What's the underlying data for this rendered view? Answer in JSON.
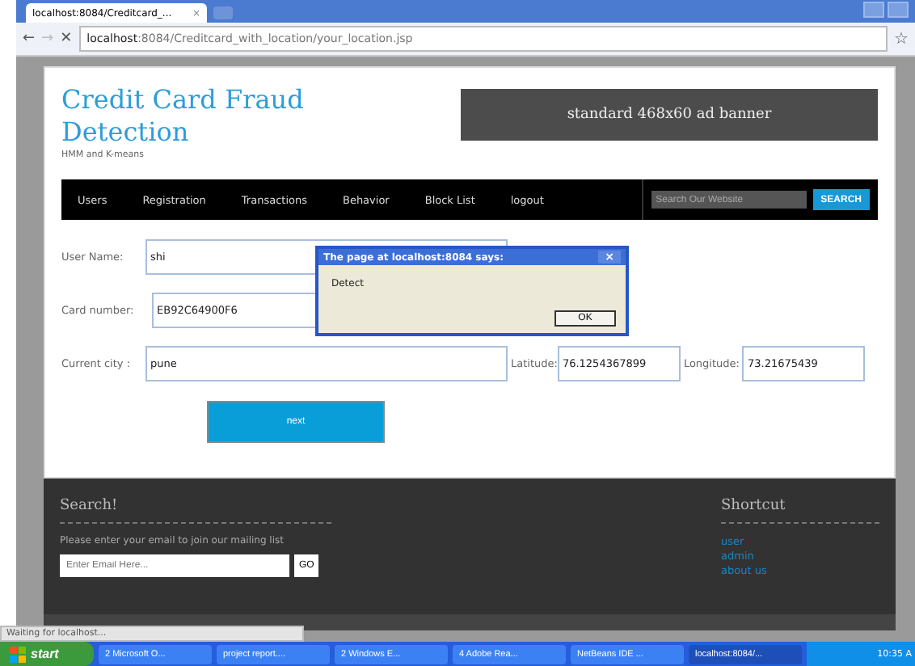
{
  "browser": {
    "tab": {
      "title": "localhost:8084/Creditcard_...",
      "close": "×"
    },
    "url_host": "localhost",
    "url_path": ":8084/Creditcard_with_location/your_location.jsp",
    "status": "Waiting for localhost...",
    "back": "←",
    "forward": "→",
    "stop": "✕",
    "star": "☆"
  },
  "header": {
    "title": "Credit Card Fraud Detection",
    "subtitle": "HMM and K-means",
    "banner": "standard 468x60 ad banner"
  },
  "nav": {
    "items": [
      "Users",
      "Registration",
      "Transactions",
      "Behavior",
      "Block List",
      "logout"
    ],
    "search_placeholder": "Search Our Website",
    "search_button": "SEARCH"
  },
  "form": {
    "user_name": {
      "label": "User Name:",
      "value": "shi"
    },
    "card_number": {
      "label": "Card number:",
      "value": "EB92C64900F6"
    },
    "city": {
      "label": "Current city :",
      "value": "pune"
    },
    "latitude": {
      "label": "Latitude:",
      "value": "76.1254367899"
    },
    "longitude": {
      "label": "Longitude:",
      "value": "73.21675439"
    },
    "button": "next"
  },
  "dialog": {
    "title": "The page at localhost:8084 says:",
    "message": "Detect",
    "ok": "OK",
    "close": "×"
  },
  "footer": {
    "search_title": "Search!",
    "text": "Please enter your email to join our mailing list",
    "email_placeholder": "Enter Email Here...",
    "go": "GO",
    "shortcut_title": "Shortcut",
    "links": [
      "user",
      "admin",
      "about us"
    ]
  },
  "taskbar": {
    "start": "start",
    "items": [
      {
        "label": "2 Microsoft O...",
        "selected": false
      },
      {
        "label": "project report....",
        "selected": false
      },
      {
        "label": "2 Windows E...",
        "selected": false
      },
      {
        "label": "4 Adobe Rea...",
        "selected": false
      },
      {
        "label": "NetBeans IDE ...",
        "selected": false
      },
      {
        "label": "localhost:8084/...",
        "selected": true
      }
    ],
    "time": "10:35 A"
  }
}
